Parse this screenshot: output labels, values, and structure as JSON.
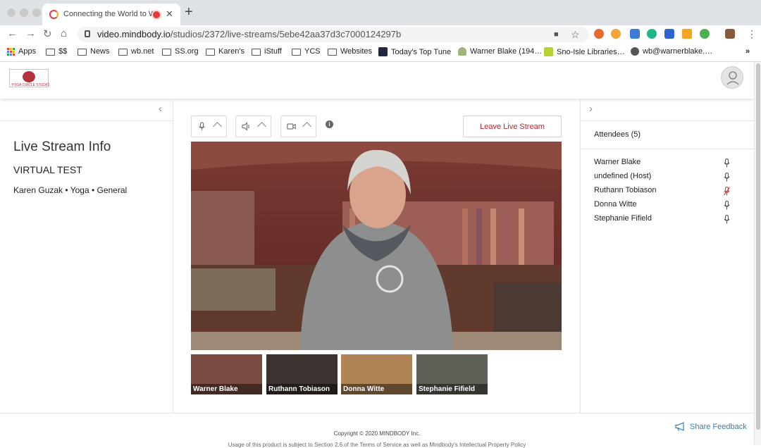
{
  "browser": {
    "tab_title": "Connecting the World to W",
    "url_host": "video.mindbody.io",
    "url_path": "/studios/2372/live-streams/5ebe42aa37d3c7000124297b",
    "bookmarks": [
      "Apps",
      "$$",
      "News",
      "wb.net",
      "SS.org",
      "Karen's",
      "iStuff",
      "YCS",
      "Websites",
      "Today's Top Tune",
      "Warner Blake (194…",
      "Sno-Isle Libraries…",
      "wb@warnerblake.…"
    ],
    "overflow": "»",
    "new_tab": "+",
    "close": "✕"
  },
  "header": {
    "logo_text": "YOGA CIRCLE STUDIO"
  },
  "left_panel": {
    "collapse": "‹",
    "title": "Live Stream Info",
    "class_name": "VIRTUAL TEST",
    "meta": "Karen Guzak • Yoga • General"
  },
  "controls": {
    "leave_label": "Leave Live Stream",
    "info": "i"
  },
  "participants": [
    "Warner Blake",
    "Ruthann Tobiason",
    "Donna Witte",
    "Stephanie Fifield"
  ],
  "right_panel": {
    "expand": "›",
    "attendees_title": "Attendees (5)",
    "attendees": [
      {
        "name": "Warner Blake",
        "muted": false
      },
      {
        "name": "undefined (Host)",
        "muted": false
      },
      {
        "name": "Ruthann Tobiason",
        "muted": true
      },
      {
        "name": "Donna Witte",
        "muted": false
      },
      {
        "name": "Stephanie Fifield",
        "muted": false
      }
    ]
  },
  "footer": {
    "copyright": "Copyright © 2020 MINDBODY Inc.",
    "terms": "Usage of this product is subject to Section 2.6 of the Terms of Service as well as Mindbody's Intellectual Property Policy",
    "feedback": "Share Feedback"
  },
  "colors": {
    "accent": "#c0262d",
    "link": "#2f7fb3",
    "muted_mic": "#d9363e"
  }
}
